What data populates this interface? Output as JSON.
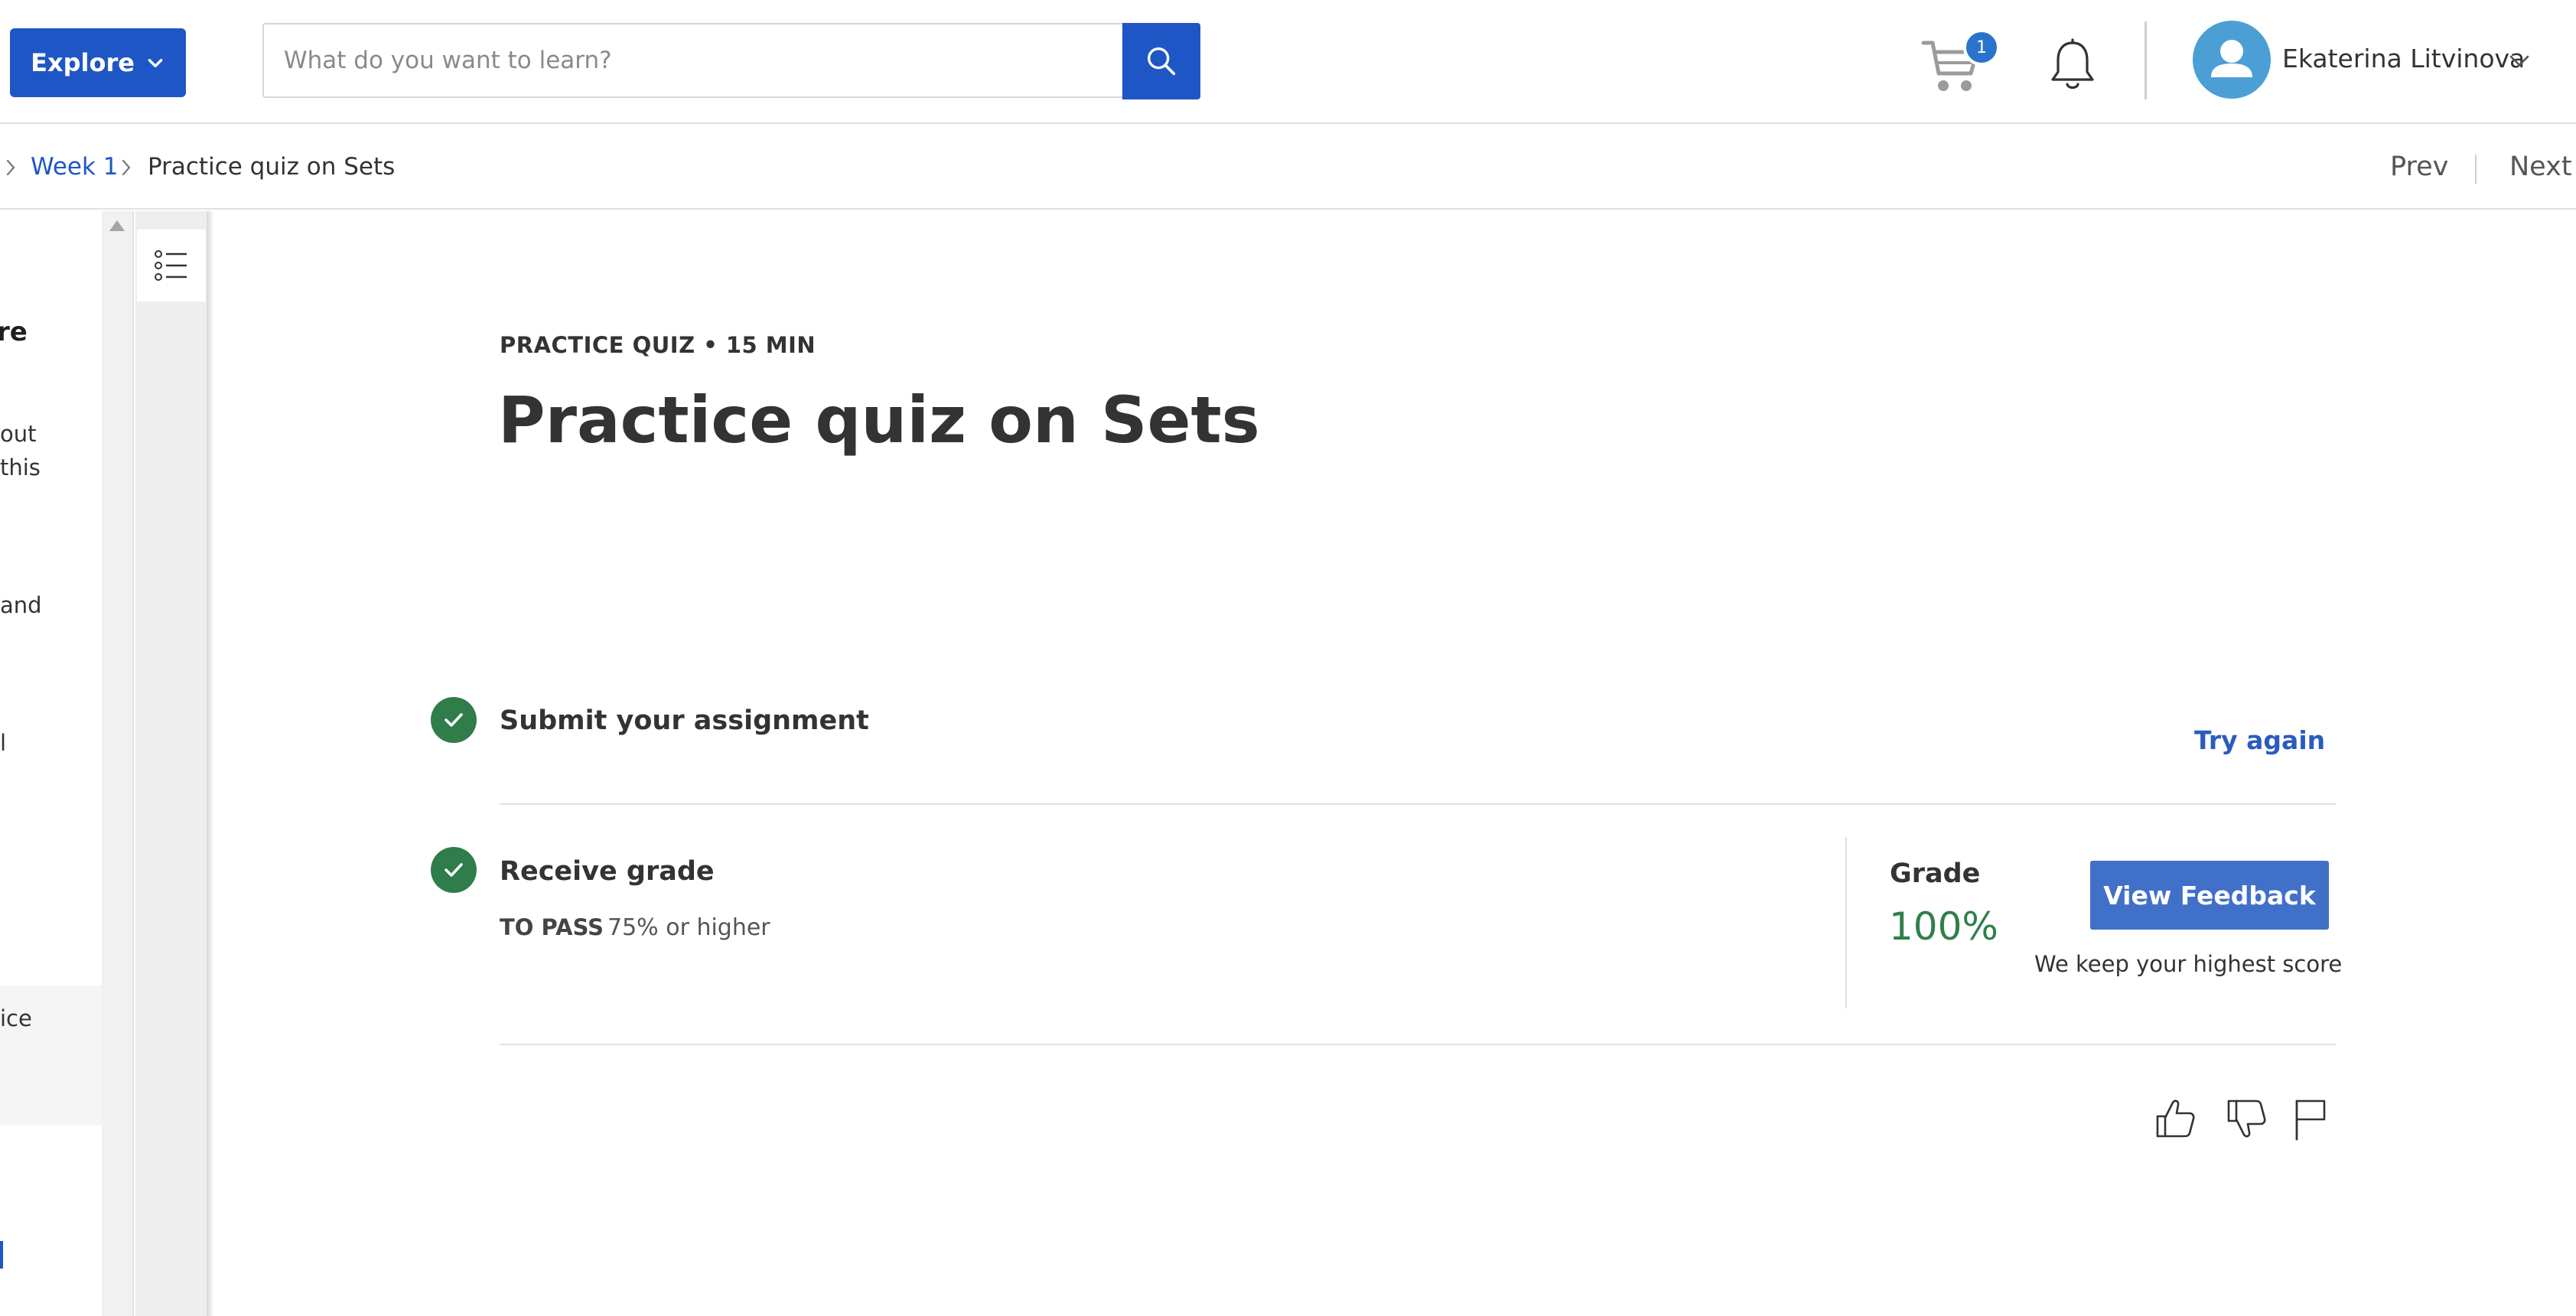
{
  "header": {
    "explore_label": "Explore",
    "search_placeholder": "What do you want to learn?",
    "cart_count": "1",
    "user_name": "Ekaterina Litvinova"
  },
  "breadcrumb": {
    "week_link": "Week 1",
    "current": "Practice quiz on Sets",
    "prev_label": "Prev",
    "next_label": "Next"
  },
  "sidebar": {
    "heading_fragment": "re",
    "fragments": [
      "out",
      "this",
      "and",
      "l",
      "ice"
    ]
  },
  "main": {
    "eyebrow": "PRACTICE QUIZ • 15 MIN",
    "title": "Practice quiz on Sets",
    "submit_step": {
      "title": "Submit your assignment",
      "action": "Try again",
      "status": "complete"
    },
    "grade_step": {
      "title": "Receive grade",
      "to_pass_label": "TO PASS",
      "to_pass_value": "75% or higher",
      "grade_label": "Grade",
      "grade_value": "100%",
      "feedback_button": "View Feedback",
      "note": "We keep your highest score",
      "status": "complete"
    }
  },
  "colors": {
    "primary": "#1f56c5",
    "success": "#2e7d4a",
    "grade_text": "#2e8049"
  },
  "icons": [
    "chevron-down-icon",
    "search-icon",
    "cart-icon",
    "bell-icon",
    "user-icon",
    "list-icon",
    "check-icon",
    "thumbs-up-icon",
    "thumbs-down-icon",
    "flag-icon"
  ]
}
